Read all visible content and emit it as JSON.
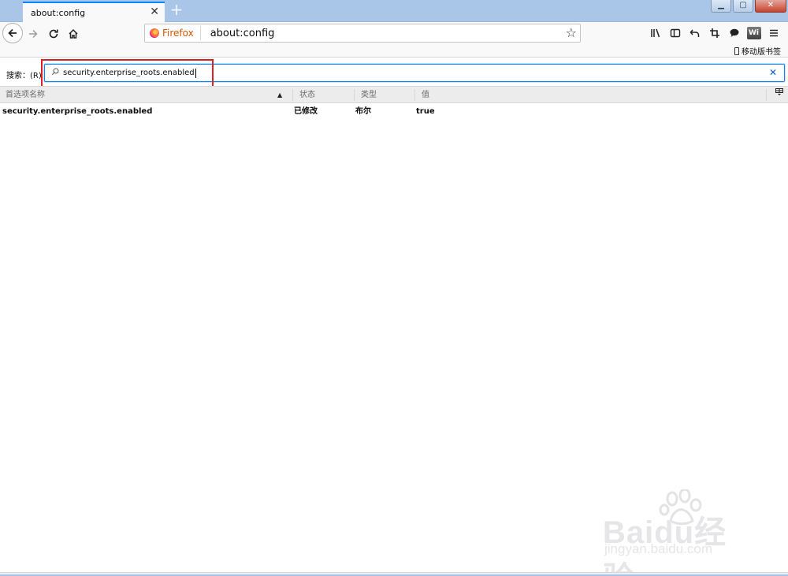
{
  "tab": {
    "title": "about:config",
    "close": "✕",
    "new_tab": "+"
  },
  "window_controls": {
    "minimize": "▁",
    "maximize": "▢",
    "close": "✕"
  },
  "urlbar": {
    "identity_label": "Firefox",
    "url": "about:config"
  },
  "bookmarks": {
    "mobile_label": "移动版书签"
  },
  "search": {
    "label": "搜索：(R)",
    "value": "security.enterprise_roots.enabled"
  },
  "table": {
    "columns": [
      "首选项名称",
      "状态",
      "类型",
      "值"
    ],
    "rows": [
      {
        "name": "security.enterprise_roots.enabled",
        "status": "已修改",
        "type": "布尔",
        "value": "true"
      }
    ]
  },
  "watermark": {
    "brand": "Baidu经验",
    "url": "jingyan.baidu.com"
  },
  "icons": [
    "back-arrow-icon",
    "forward-arrow-icon",
    "reload-icon",
    "home-icon",
    "star-icon",
    "library-icon",
    "sidebar-icon",
    "undo-icon",
    "crop-icon",
    "chat-icon",
    "wifi-icon",
    "menu-icon",
    "phone-icon",
    "search-icon",
    "clear-icon",
    "column-picker-icon"
  ],
  "colors": {
    "accent": "#0a84ff",
    "highlight_box": "#e02020",
    "tabstrip": "#a9c6e8"
  }
}
